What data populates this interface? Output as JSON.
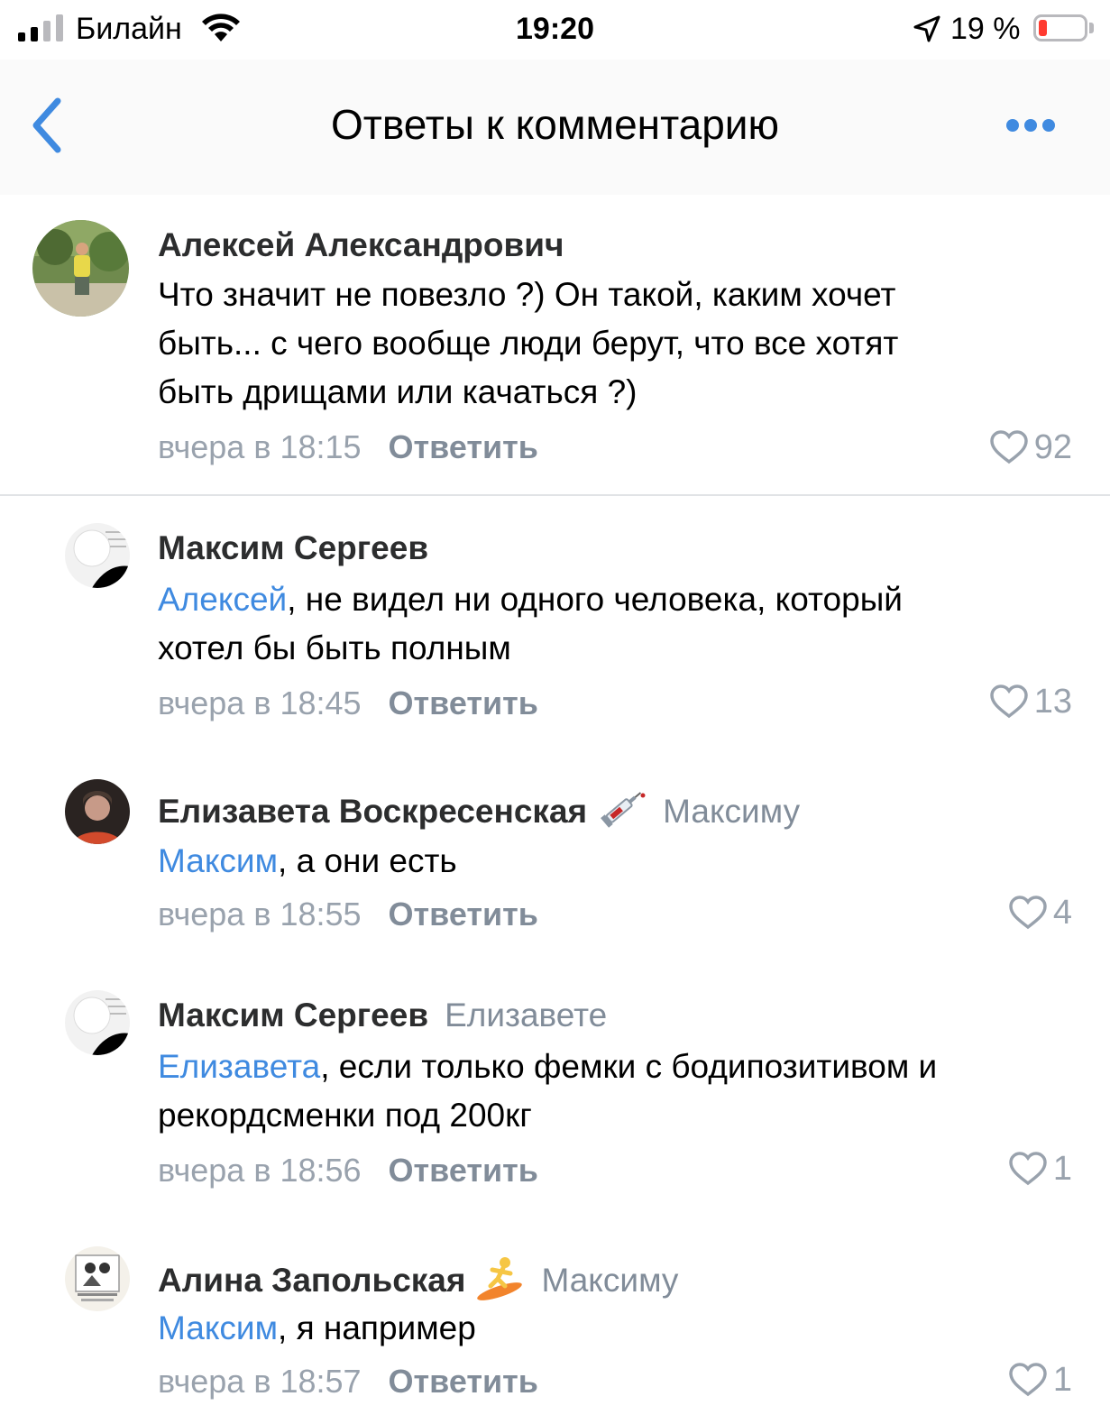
{
  "status_bar": {
    "carrier": "Билайн",
    "time": "19:20",
    "battery_percent": "19 %",
    "battery_level": 0.19,
    "icons": [
      "cellular-signal-icon",
      "wifi-icon",
      "location-arrow-icon",
      "battery-icon"
    ]
  },
  "nav": {
    "title": "Ответы к комментарию",
    "back_icon": "chevron-left-icon",
    "more_icon": "more-dots-icon",
    "accent_color": "#3f8ae0"
  },
  "comments": [
    {
      "author": "Алексей Александрович",
      "text_lines": [
        "Что значит не повезло ?) Он такой, каким хочет",
        "быть... с чего вообще люди берут, что все хотят",
        "быть дрищами или качаться ?)"
      ],
      "time": "вчера в 18:15",
      "reply_label": "Ответить",
      "likes": "92"
    },
    {
      "author": "Максим Сергеев",
      "mention": "Алексей",
      "text_rest": ", не видел ни одного человека, который",
      "text_line2": "хотел бы быть полным",
      "time": "вчера в 18:45",
      "reply_label": "Ответить",
      "likes": "13"
    },
    {
      "author": "Елизавета Воскресенская",
      "emoji": "syringe-emoji",
      "reply_to": "Максиму",
      "mention": "Максим",
      "text_rest": ", а они есть",
      "time": "вчера в 18:55",
      "reply_label": "Ответить",
      "likes": "4"
    },
    {
      "author": "Максим Сергеев",
      "reply_to": "Елизавете",
      "mention": "Елизавета",
      "text_rest": ", если только фемки с бодипозитивом и",
      "text_line2": "рекордсменки под 200кг",
      "time": "вчера в 18:56",
      "reply_label": "Ответить",
      "likes": "1"
    },
    {
      "author": "Алина Запольская",
      "emoji": "surfer-emoji",
      "reply_to": "Максиму",
      "mention": "Максим",
      "text_rest": ", я например",
      "time": "вчера в 18:57",
      "reply_label": "Ответить",
      "likes": "1"
    }
  ]
}
